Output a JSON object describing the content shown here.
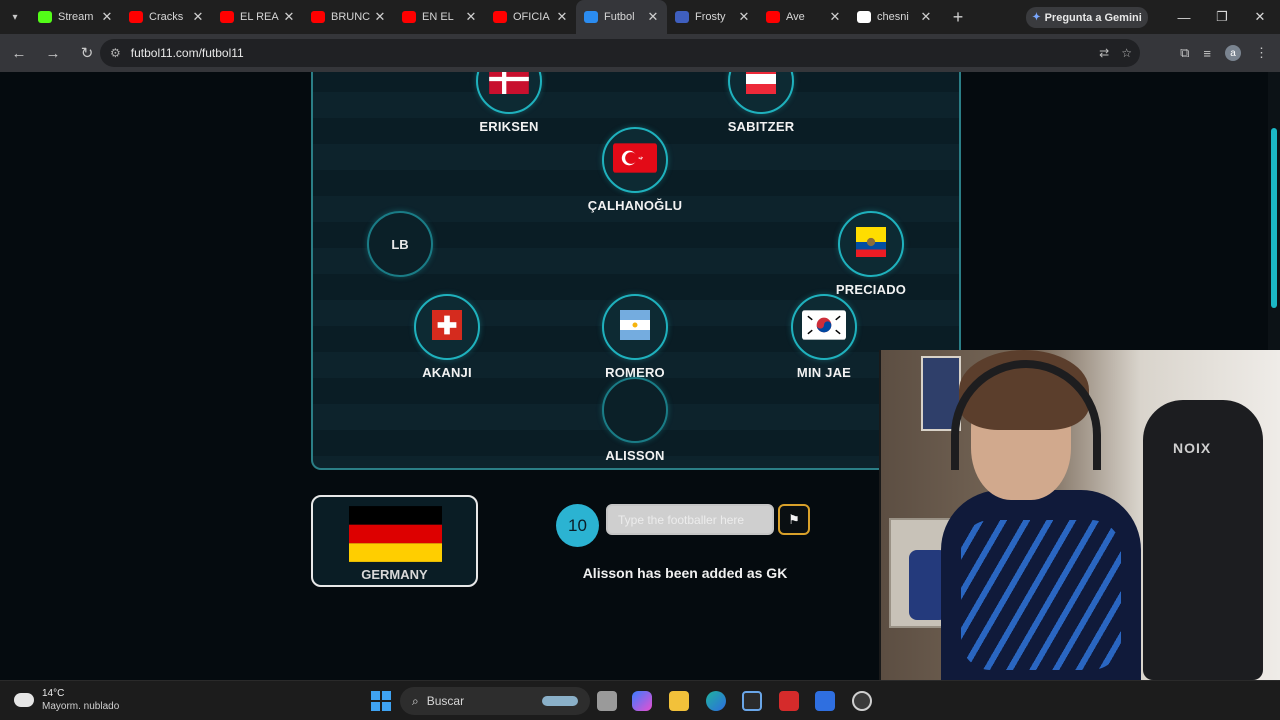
{
  "browser": {
    "tabs": [
      {
        "label": "Stream",
        "fav_color": "#53fc18"
      },
      {
        "label": "Cracks",
        "fav_color": "#ff0000"
      },
      {
        "label": "EL REA",
        "fav_color": "#ff0000"
      },
      {
        "label": "BRUNC",
        "fav_color": "#ff0000"
      },
      {
        "label": "EN EL ",
        "fav_color": "#ff0000"
      },
      {
        "label": "OFICIA",
        "fav_color": "#ff0000"
      },
      {
        "label": "Futbol",
        "fav_color": "#2b8cf0",
        "active": true
      },
      {
        "label": "Frosty",
        "fav_color": "#3f5fbf"
      },
      {
        "label": "Ave",
        "fav_color": "#ff0000"
      },
      {
        "label": "chesni",
        "fav_color": "#ffffff"
      }
    ],
    "gemini_label": "Pregunta a Gemini",
    "url": "futbol11.com/futbol11",
    "profile_initial": "a"
  },
  "pitch": {
    "players": [
      {
        "name": "ERIKSEN",
        "flag": "denmark"
      },
      {
        "name": "SABITZER",
        "flag": "austria"
      },
      {
        "name": "ÇALHANOĞLU",
        "flag": "turkey"
      },
      {
        "name": "",
        "position": "LB",
        "flag": "empty"
      },
      {
        "name": "PRECIADO",
        "flag": "ecuador"
      },
      {
        "name": "AKANJI",
        "flag": "switzerland"
      },
      {
        "name": "ROMERO",
        "flag": "argentina"
      },
      {
        "name": "MIN JAE",
        "flag": "korea"
      },
      {
        "name": "ALISSON",
        "flag": "empty"
      }
    ]
  },
  "game": {
    "country": "GERMANY",
    "guesses_left": "10",
    "input_placeholder": "Type the footballer here",
    "status": "Alisson has been added as GK"
  },
  "webcam": {
    "chair_brand": "NOIX"
  },
  "taskbar": {
    "temperature": "14°C",
    "weather": "Mayorm. nublado",
    "search_label": "Buscar"
  }
}
